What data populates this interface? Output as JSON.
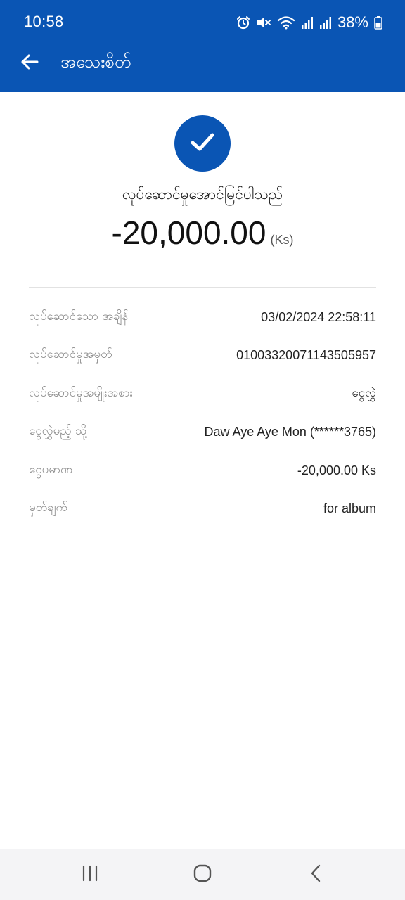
{
  "status_bar": {
    "time": "10:58",
    "battery": "38%",
    "icons": [
      "alarm-icon",
      "mute-icon",
      "wifi-icon",
      "signal-icon",
      "signal-icon",
      "battery-icon"
    ]
  },
  "app_bar": {
    "title": "အသေးစိတ်",
    "back_icon": "arrow-left-icon"
  },
  "success": {
    "icon": "check-icon",
    "message": "လုပ်ဆောင်မှုအောင်မြင်ပါသည်",
    "amount": "-20,000.00",
    "unit": "(Ks)"
  },
  "details": [
    {
      "label": "လုပ်ဆောင်သော အချိန်",
      "value": "03/02/2024 22:58:11"
    },
    {
      "label": "လုပ်ဆောင်မှုအမှတ်",
      "value": "01003320071143505957"
    },
    {
      "label": "လုပ်ဆောင်မှုအမျိုးအစား",
      "value": "ငွေလွှဲ"
    },
    {
      "label": "ငွေလွှဲမည့် သို့",
      "value": "Daw Aye Aye Mon (******3765)"
    },
    {
      "label": "ငွေပမာဏ",
      "value": "-20,000.00 Ks"
    },
    {
      "label": "မှတ်ချက်",
      "value": "for album"
    }
  ],
  "nav_bar": {
    "buttons": [
      "recent-apps-icon",
      "home-icon",
      "back-icon"
    ]
  },
  "colors": {
    "primary": "#0a55b4",
    "label_gray": "#8a8a8a",
    "nav_bg": "#f4f4f6"
  }
}
